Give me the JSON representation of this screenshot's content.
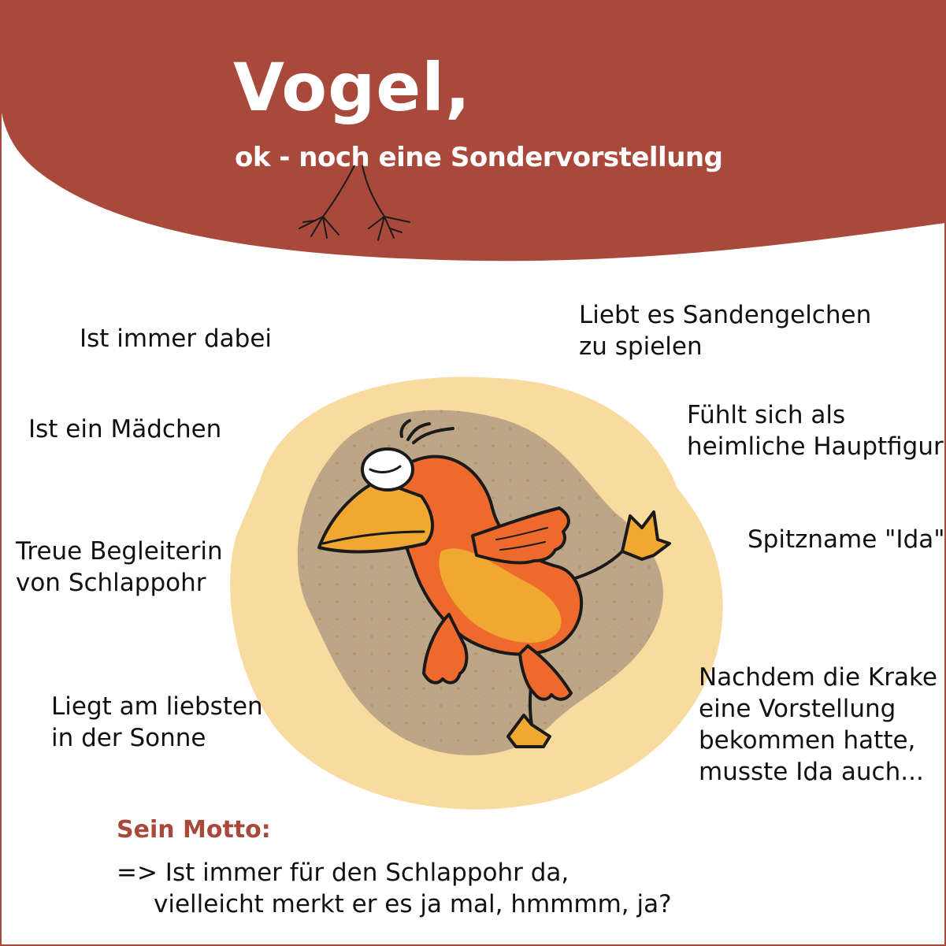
{
  "header": {
    "title": "Vogel,",
    "subtitle": "ok - noch eine Sondervorstellung"
  },
  "facts_left": [
    {
      "line1": "Ist immer dabei",
      "line2": ""
    },
    {
      "line1": "Ist ein Mädchen",
      "line2": ""
    },
    {
      "line1": "Treue Begleiterin",
      "line2": "von Schlappohr"
    },
    {
      "line1": "Liegt am liebsten",
      "line2": "in der Sonne"
    }
  ],
  "facts_right": [
    {
      "line1": "Liebt es Sandengelchen",
      "line2": "zu spielen"
    },
    {
      "line1": "Fühlt sich als",
      "line2": "heimliche Hauptfigur"
    },
    {
      "line1": "Spitzname \"Ida\"",
      "line2": ""
    },
    {
      "line1": "Nachdem die Krake",
      "line2": "eine Vorstellung",
      "line3": "bekommen hatte,",
      "line4": "musste Ida auch..."
    }
  ],
  "motto": {
    "label": "Sein Motto:",
    "line1": "=> Ist immer für den Schlappohr da,",
    "line2": "vielleicht merkt er es ja mal, hmmmm, ja?"
  },
  "colors": {
    "header": "#a9493b",
    "sand_light": "#f8dc9f",
    "sand_dark": "#bda688",
    "bird_orange": "#ee6a2c",
    "bird_yellow": "#f0a833"
  },
  "icons": {
    "feet": "bird-feet-icon",
    "bird": "bird-illustration"
  }
}
